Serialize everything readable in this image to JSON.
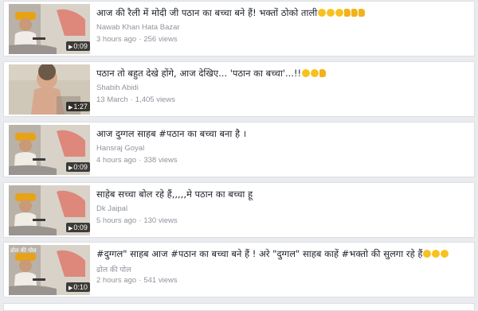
{
  "videos": [
    {
      "title": "आज की रैली में मोदी जी पठान का बच्चा बने हैं! भक्तों ठोको ताली",
      "title_emojis": [
        "laughing",
        "laughing",
        "laughing"
      ],
      "title_hands": [
        "pointing-down",
        "pointing-down",
        "pointing-down"
      ],
      "author": "Nawab Khan Hata Bazar",
      "time": "3 hours ago",
      "views": "256 views",
      "duration": "0:09",
      "thumb_corner_text": "",
      "thumb_kind": "speaker"
    },
    {
      "title": "पठान तो बहुत देखे होंगे, आज देखिए... 'पठान का बच्चा'...!!",
      "title_emojis": [
        "heart-eyes",
        "laughing"
      ],
      "title_hands": [
        "pointing-down"
      ],
      "author": "Shabih Abidi",
      "time": "13 March",
      "views": "1,405 views",
      "duration": "1:27",
      "thumb_corner_text": "",
      "thumb_kind": "child"
    },
    {
      "title": "आज दुग्गल साहब #पठान का बच्चा बना है ।",
      "title_emojis": [],
      "title_hands": [],
      "author": "Hansraj Goyal",
      "time": "4 hours ago",
      "views": "338 views",
      "duration": "0:09",
      "thumb_corner_text": "",
      "thumb_kind": "speaker"
    },
    {
      "title": "साहेब सच्चा बोल रहे हैं,,,,,मे पठान का बच्चा हू",
      "title_emojis": [],
      "title_hands": [],
      "author": "Dk Jaipal",
      "time": "5 hours ago",
      "views": "130 views",
      "duration": "0:09",
      "thumb_corner_text": "",
      "thumb_kind": "speaker"
    },
    {
      "title": "#दुग्गल\" साहब आज #पठान का बच्चा बने हैं ! अरे \"दुग्गल\" साहब काहें #भक्तो की सुलगा रहे हैं",
      "title_emojis": [
        "laughing",
        "laughing",
        "laughing"
      ],
      "title_hands": [],
      "author": "ढोल की पोल",
      "time": "2 hours ago",
      "views": "541 views",
      "duration": "0:10",
      "thumb_corner_text": "ढोल की पोल",
      "thumb_kind": "speaker"
    }
  ],
  "colors": {
    "page_bg": "#e9ebee",
    "card_border": "#dddfe2",
    "title_text": "#1d2129",
    "meta_text": "#90949c"
  },
  "icons": {
    "play": "play-icon",
    "emoji": "emoji-icon",
    "hand": "pointing-down-icon"
  }
}
